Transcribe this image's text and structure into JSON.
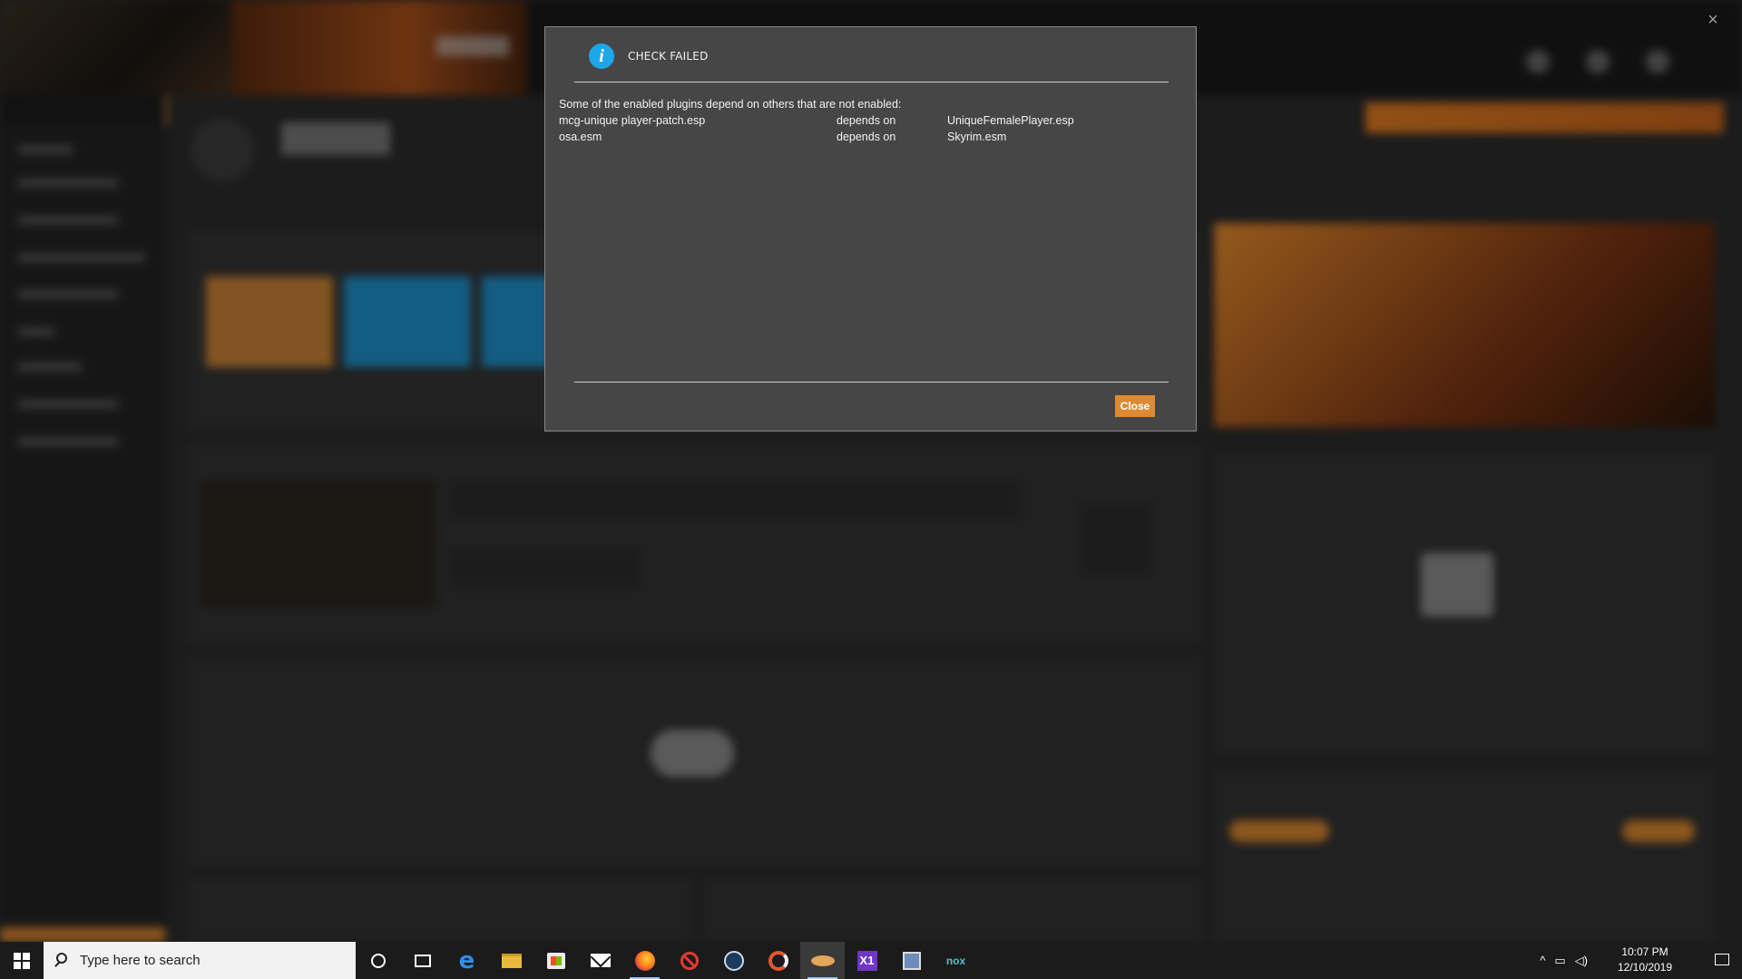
{
  "dialog": {
    "title": "CHECK FAILED",
    "intro": "Some of the enabled plugins depend on others that are not enabled:",
    "rows": [
      {
        "plugin": "mcg-unique player-patch.esp",
        "relation": "depends on",
        "dependency": "UniqueFemalePlayer.esp"
      },
      {
        "plugin": "osa.esm",
        "relation": "depends on",
        "dependency": "Skyrim.esm"
      }
    ],
    "close_label": "Close",
    "icon": "info-icon"
  },
  "window": {
    "close_glyph": "×"
  },
  "taskbar": {
    "search_placeholder": "Type here to search",
    "time": "10:07 PM",
    "date": "12/10/2019",
    "apps": [
      "cortana",
      "task-view",
      "edge",
      "file-explorer",
      "store",
      "mail",
      "firefox",
      "blocked-app",
      "steam",
      "swirl-app",
      "vortex",
      "visual-studio",
      "tool-app",
      "nox"
    ]
  },
  "colors": {
    "accent": "#de8a33",
    "info": "#1ea7e8",
    "dialog_bg": "#464646"
  }
}
